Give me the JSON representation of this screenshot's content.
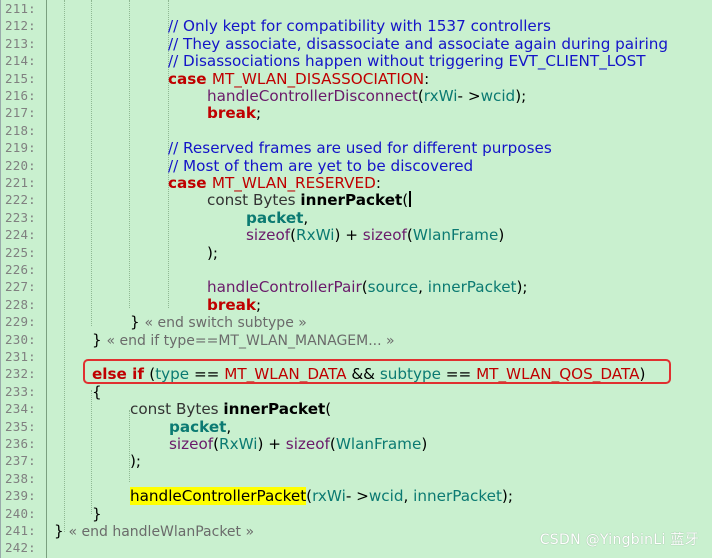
{
  "editor": {
    "lines": [
      {
        "n": "211:",
        "t": []
      },
      {
        "n": "212:",
        "t": [
          [
            "cm",
            "// Only kept for compatibility with 1537 controllers"
          ]
        ]
      },
      {
        "n": "213:",
        "t": [
          [
            "cm",
            "// They associate, disassociate and associate again during pairing"
          ]
        ]
      },
      {
        "n": "214:",
        "t": [
          [
            "cm",
            "// Disassociations happen without triggering EVT_CLIENT_LOST"
          ]
        ]
      },
      {
        "n": "215:",
        "t": [
          [
            "kw",
            "case "
          ],
          [
            "cn",
            "MT_WLAN_DISASSOCIATION"
          ],
          [
            "op",
            ":"
          ]
        ]
      },
      {
        "n": "216:",
        "t": [
          [
            "fn",
            "handleControllerDisconnect"
          ],
          [
            "op",
            "("
          ],
          [
            "id",
            "rxWi"
          ],
          [
            "op",
            "- >"
          ],
          [
            "id",
            "wcid"
          ],
          [
            "op",
            ");"
          ]
        ]
      },
      {
        "n": "217:",
        "t": [
          [
            "kw",
            "break"
          ],
          [
            "op",
            ";"
          ]
        ]
      },
      {
        "n": "218:",
        "t": []
      },
      {
        "n": "219:",
        "t": [
          [
            "cm",
            "// Reserved frames are used for different purposes"
          ]
        ]
      },
      {
        "n": "220:",
        "t": [
          [
            "cm",
            "// Most of them are yet to be discovered"
          ]
        ]
      },
      {
        "n": "221:",
        "t": [
          [
            "kw",
            "case "
          ],
          [
            "cn",
            "MT_WLAN_RESERVED"
          ],
          [
            "op",
            ":"
          ]
        ]
      },
      {
        "n": "222:",
        "t": [
          [
            "ty",
            "const Bytes "
          ],
          [
            "bd",
            "innerPacket"
          ],
          [
            "op",
            "("
          ],
          [
            "caret",
            ""
          ]
        ]
      },
      {
        "n": "223:",
        "t": [
          [
            "par",
            "packet"
          ],
          [
            "op",
            ","
          ]
        ]
      },
      {
        "n": "224:",
        "t": [
          [
            "fn",
            "sizeof"
          ],
          [
            "op",
            "("
          ],
          [
            "id",
            "RxWi"
          ],
          [
            "op",
            ") + "
          ],
          [
            "fn",
            "sizeof"
          ],
          [
            "op",
            "("
          ],
          [
            "id",
            "WlanFrame"
          ],
          [
            "op",
            ")"
          ]
        ]
      },
      {
        "n": "225:",
        "t": [
          [
            "op",
            ");"
          ]
        ]
      },
      {
        "n": "226:",
        "t": []
      },
      {
        "n": "227:",
        "t": [
          [
            "fn",
            "handleControllerPair"
          ],
          [
            "op",
            "("
          ],
          [
            "id",
            "source"
          ],
          [
            "op",
            ", "
          ],
          [
            "id",
            "innerPacket"
          ],
          [
            "op",
            ");"
          ]
        ]
      },
      {
        "n": "228:",
        "t": [
          [
            "kw",
            "break"
          ],
          [
            "op",
            ";"
          ]
        ]
      },
      {
        "n": "229:",
        "t": [
          [
            "op",
            "} "
          ],
          [
            "fold",
            "« end switch subtype »"
          ]
        ]
      },
      {
        "n": "230:",
        "t": [
          [
            "op",
            "} "
          ],
          [
            "fold",
            "« end if type==MT_WLAN_MANAGEM... »"
          ]
        ]
      },
      {
        "n": "231:",
        "t": []
      },
      {
        "n": "232:",
        "t": [
          [
            "kw",
            "else if "
          ],
          [
            "op",
            "("
          ],
          [
            "id",
            "type"
          ],
          [
            "op",
            " == "
          ],
          [
            "cn",
            "MT_WLAN_DATA"
          ],
          [
            "op",
            " && "
          ],
          [
            "id",
            "subtype"
          ],
          [
            "op",
            " == "
          ],
          [
            "cn",
            "MT_WLAN_QOS_DATA"
          ],
          [
            "op",
            ")"
          ]
        ]
      },
      {
        "n": "233:",
        "t": [
          [
            "op",
            "{"
          ]
        ]
      },
      {
        "n": "234:",
        "t": [
          [
            "ty",
            "const Bytes "
          ],
          [
            "bd",
            "innerPacket"
          ],
          [
            "op",
            "("
          ]
        ]
      },
      {
        "n": "235:",
        "t": [
          [
            "par",
            "packet"
          ],
          [
            "op",
            ","
          ]
        ]
      },
      {
        "n": "236:",
        "t": [
          [
            "fn",
            "sizeof"
          ],
          [
            "op",
            "("
          ],
          [
            "id",
            "RxWi"
          ],
          [
            "op",
            ") + "
          ],
          [
            "fn",
            "sizeof"
          ],
          [
            "op",
            "("
          ],
          [
            "id",
            "WlanFrame"
          ],
          [
            "op",
            ")"
          ]
        ]
      },
      {
        "n": "237:",
        "t": [
          [
            "op",
            ");"
          ]
        ]
      },
      {
        "n": "238:",
        "t": []
      },
      {
        "n": "239:",
        "t": [
          [
            "hl",
            "handleControllerPacket"
          ],
          [
            "op",
            "("
          ],
          [
            "id",
            "rxWi"
          ],
          [
            "op",
            "- >"
          ],
          [
            "id",
            "wcid"
          ],
          [
            "op",
            ", "
          ],
          [
            "id",
            "innerPacket"
          ],
          [
            "op",
            ");"
          ]
        ]
      },
      {
        "n": "240:",
        "t": [
          [
            "op",
            "}"
          ]
        ]
      },
      {
        "n": "241:",
        "t": [
          [
            "op",
            "} "
          ],
          [
            "fold",
            "« end handleWlanPacket »"
          ]
        ]
      },
      {
        "n": "242:",
        "t": []
      }
    ],
    "highlight_box_color": "#e03030",
    "background": "#c9f0cf"
  },
  "watermark": "CSDN @YingbinLi 蓝牙"
}
